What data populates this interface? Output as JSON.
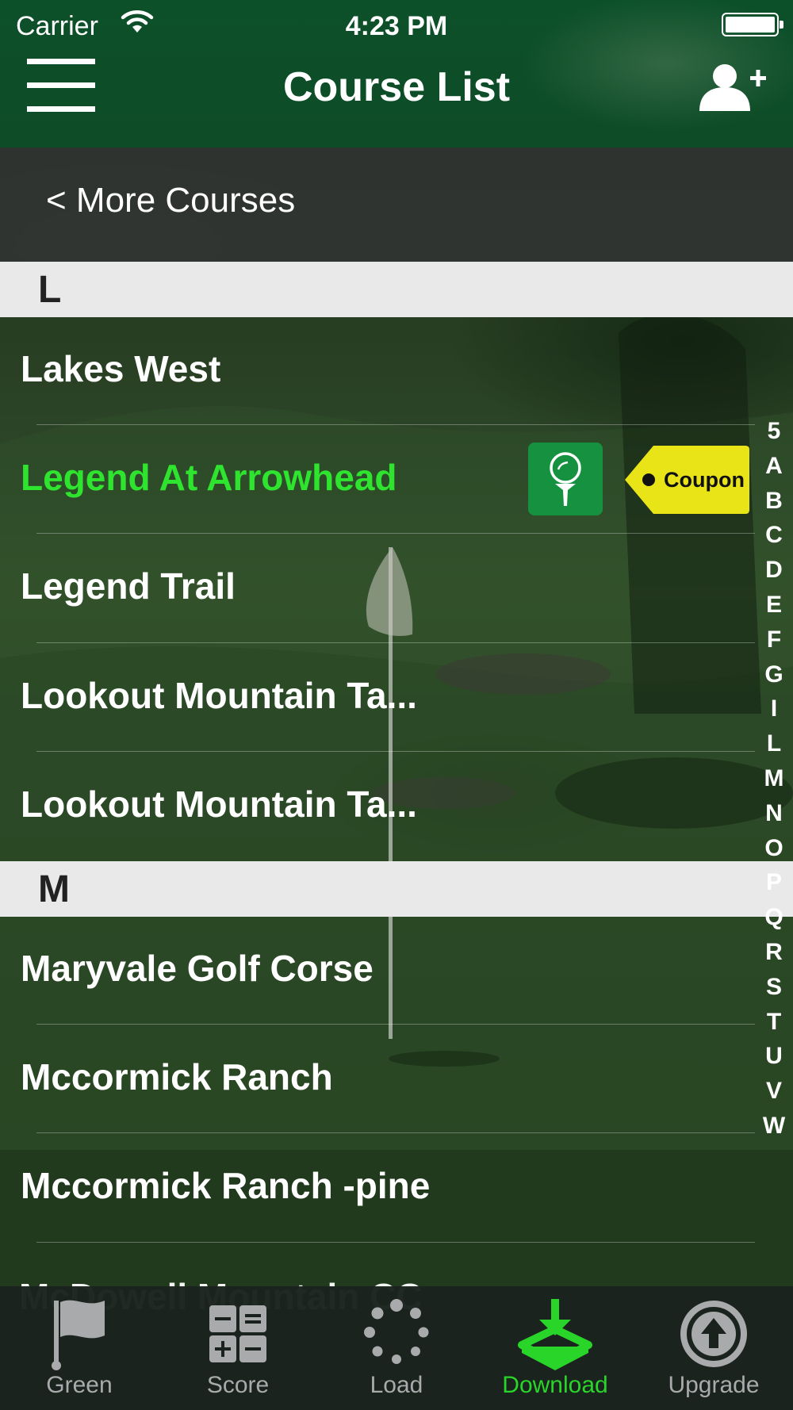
{
  "status_bar": {
    "carrier": "Carrier",
    "time": "4:23 PM"
  },
  "nav": {
    "title": "Course List"
  },
  "more_courses": {
    "label": "< More Courses"
  },
  "sections": [
    {
      "letter": "L",
      "courses": [
        {
          "name": "Lakes West"
        },
        {
          "name": "Legend At Arrowhead",
          "highlighted": true,
          "badges": [
            "golf-tee-icon",
            "coupon-tag"
          ]
        },
        {
          "name": "Legend Trail"
        },
        {
          "name": "Lookout Mountain Ta..."
        },
        {
          "name": "Lookout Mountain Ta..."
        }
      ]
    },
    {
      "letter": "M",
      "courses": [
        {
          "name": "Maryvale Golf Corse"
        },
        {
          "name": "Mccormick Ranch"
        },
        {
          "name": "Mccormick Ranch -pine"
        },
        {
          "name": "McDowell Mountain CC"
        }
      ]
    }
  ],
  "coupon": {
    "label": "Coupon"
  },
  "index": [
    "5",
    "A",
    "B",
    "C",
    "D",
    "E",
    "F",
    "G",
    "I",
    "L",
    "M",
    "N",
    "O",
    "P",
    "Q",
    "R",
    "S",
    "T",
    "U",
    "V",
    "W"
  ],
  "tabs": [
    {
      "label": "Green",
      "icon": "flag-icon",
      "active": false
    },
    {
      "label": "Score",
      "icon": "calculator-icon",
      "active": false
    },
    {
      "label": "Load",
      "icon": "loading-spinner-icon",
      "active": false
    },
    {
      "label": "Download",
      "icon": "download-icon",
      "active": true
    },
    {
      "label": "Upgrade",
      "icon": "upgrade-arrow-icon",
      "active": false
    }
  ],
  "colors": {
    "nav_green": "#0c522a",
    "highlight_green": "#2fe42f",
    "active_tab": "#2ad52a",
    "section_header_bg": "#e9e9ea",
    "coupon_yellow": "#e9e418",
    "tee_badge": "#16913f"
  }
}
